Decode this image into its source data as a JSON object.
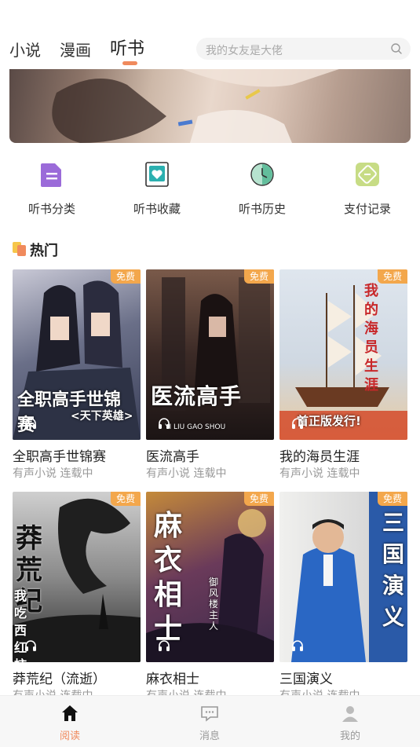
{
  "header": {
    "tabs": [
      {
        "label": "小说",
        "active": false
      },
      {
        "label": "漫画",
        "active": false
      },
      {
        "label": "听书",
        "active": true
      }
    ],
    "search": {
      "placeholder": "我的女友是大佬",
      "icon": "search-icon"
    }
  },
  "quick_links": [
    {
      "label": "听书分类",
      "icon": "category-doc-icon",
      "color": "#9b6bd9"
    },
    {
      "label": "听书收藏",
      "icon": "favorite-heart-icon",
      "color": "#2bb0b0"
    },
    {
      "label": "听书历史",
      "icon": "history-clock-icon",
      "color": "#2aa57a"
    },
    {
      "label": "支付记录",
      "icon": "payment-ticket-icon",
      "color": "#9bbf3a"
    }
  ],
  "section": {
    "title": "热门",
    "icon": "hot-icon"
  },
  "books": [
    {
      "name": "全职高手世锦赛",
      "meta": "有声小说 连载中",
      "badge": "免费",
      "cover_text": "全职高手世锦赛",
      "cover_sub": "<天下英雄>",
      "cover_colors": [
        "#3a3f58",
        "#c9c9d6"
      ]
    },
    {
      "name": "医流高手",
      "meta": "有声小说 连载中",
      "badge": "免费",
      "cover_text": "医流高手",
      "cover_sub": "YI LIU GAO SHOU",
      "cover_colors": [
        "#2a1f1f",
        "#7a5a4a"
      ]
    },
    {
      "name": "我的海员生涯",
      "meta": "有声小说 连载中",
      "badge": "免费",
      "cover_text": "我的海员生涯",
      "cover_sub": "首正版发行!",
      "cover_colors": [
        "#cfd8e2",
        "#e8c9a0"
      ]
    },
    {
      "name": "莽荒纪（流逝）",
      "meta": "有声小说 连载中",
      "badge": "免费",
      "cover_text": "莽荒纪",
      "cover_sub": "我吃西红柿",
      "cover_colors": [
        "#2b2b2b",
        "#9a9a9a"
      ]
    },
    {
      "name": "麻衣相士",
      "meta": "有声小说 连载中",
      "badge": "免费",
      "cover_text": "麻衣相士",
      "cover_sub": "御风楼主人",
      "cover_colors": [
        "#3a2a4a",
        "#c48a3a"
      ]
    },
    {
      "name": "三国演义",
      "meta": "有声小说 连载中",
      "badge": "免费",
      "cover_text": "三国演义",
      "cover_sub": "",
      "cover_colors": [
        "#d8d8d8",
        "#2a5aa8"
      ]
    }
  ],
  "bottom_nav": [
    {
      "label": "阅读",
      "icon": "home-icon",
      "active": true
    },
    {
      "label": "消息",
      "icon": "message-icon",
      "active": false
    },
    {
      "label": "我的",
      "icon": "profile-icon",
      "active": false
    }
  ],
  "colors": {
    "accent": "#f08a5d",
    "badge": "#f3a74c"
  }
}
